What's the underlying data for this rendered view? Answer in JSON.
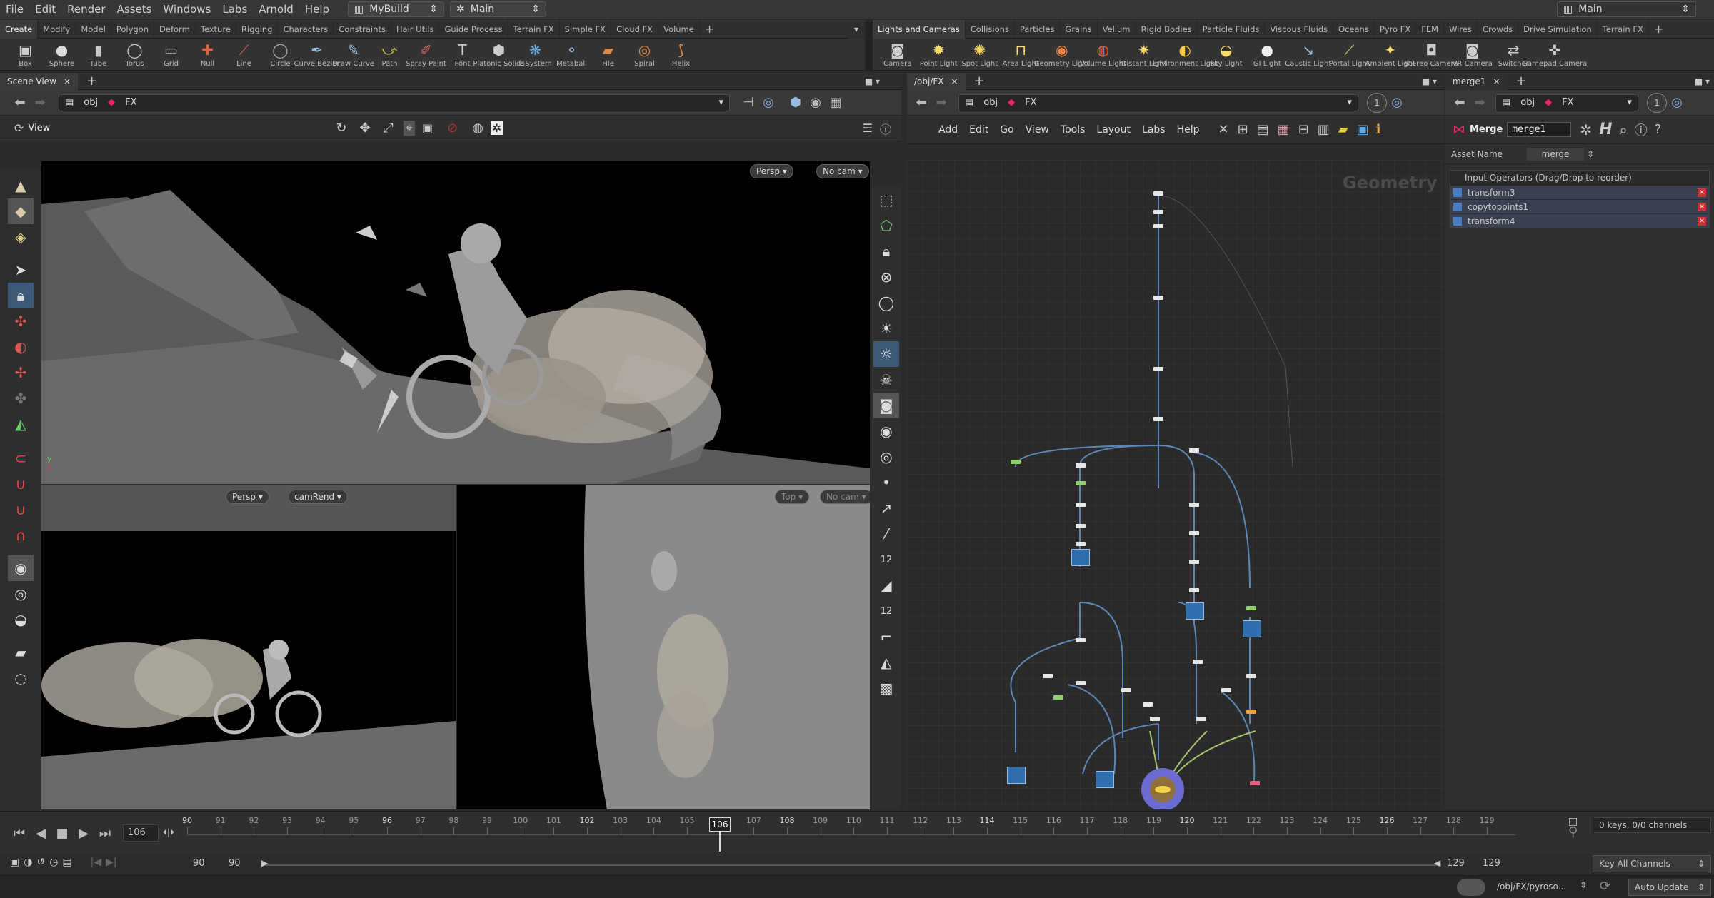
{
  "menubar": {
    "items": [
      "File",
      "Edit",
      "Render",
      "Assets",
      "Windows",
      "Labs",
      "Arnold",
      "Help"
    ],
    "build_dropdown": "MyBuild",
    "desktop_dropdown": "Main",
    "right_desktop": "Main"
  },
  "left_shelf": {
    "tabs": [
      "Create",
      "Modify",
      "Model",
      "Polygon",
      "Deform",
      "Texture",
      "Rigging",
      "Characters",
      "Constraints",
      "Hair Utils",
      "Guide Process",
      "Terrain FX",
      "Simple FX",
      "Cloud FX",
      "Volume"
    ],
    "active_tab": "Create",
    "tools": [
      {
        "label": "Box",
        "icon": "box-icon"
      },
      {
        "label": "Sphere",
        "icon": "sphere-icon"
      },
      {
        "label": "Tube",
        "icon": "tube-icon"
      },
      {
        "label": "Torus",
        "icon": "torus-icon"
      },
      {
        "label": "Grid",
        "icon": "grid-icon"
      },
      {
        "label": "Null",
        "icon": "null-icon"
      },
      {
        "label": "Line",
        "icon": "line-icon"
      },
      {
        "label": "Circle",
        "icon": "circle-icon"
      },
      {
        "label": "Curve Bezier",
        "icon": "curve-bezier-icon"
      },
      {
        "label": "Draw Curve",
        "icon": "draw-curve-icon"
      },
      {
        "label": "Path",
        "icon": "path-icon"
      },
      {
        "label": "Spray Paint",
        "icon": "spray-paint-icon"
      },
      {
        "label": "Font",
        "icon": "font-icon"
      },
      {
        "label": "Platonic Solids",
        "icon": "platonic-icon"
      },
      {
        "label": "L-System",
        "icon": "lsystem-icon"
      },
      {
        "label": "Metaball",
        "icon": "metaball-icon"
      },
      {
        "label": "File",
        "icon": "file-icon"
      },
      {
        "label": "Spiral",
        "icon": "spiral-icon"
      },
      {
        "label": "Helix",
        "icon": "helix-icon"
      }
    ]
  },
  "right_shelf": {
    "tabs": [
      "Lights and Cameras",
      "Collisions",
      "Particles",
      "Grains",
      "Vellum",
      "Rigid Bodies",
      "Particle Fluids",
      "Viscous Fluids",
      "Oceans",
      "Pyro FX",
      "FEM",
      "Wires",
      "Crowds",
      "Drive Simulation",
      "Terrain FX"
    ],
    "active_tab": "Lights and Cameras",
    "tools": [
      {
        "label": "Camera",
        "icon": "camera-icon"
      },
      {
        "label": "Point Light",
        "icon": "point-light-icon"
      },
      {
        "label": "Spot Light",
        "icon": "spot-light-icon"
      },
      {
        "label": "Area Light",
        "icon": "area-light-icon"
      },
      {
        "label": "Geometry Light",
        "icon": "geometry-light-icon"
      },
      {
        "label": "Volume Light",
        "icon": "volume-light-icon"
      },
      {
        "label": "Distant Light",
        "icon": "distant-light-icon"
      },
      {
        "label": "Environment Light",
        "icon": "environment-light-icon"
      },
      {
        "label": "Sky Light",
        "icon": "sky-light-icon"
      },
      {
        "label": "GI Light",
        "icon": "gi-light-icon"
      },
      {
        "label": "Caustic Light",
        "icon": "caustic-light-icon"
      },
      {
        "label": "Portal Light",
        "icon": "portal-light-icon"
      },
      {
        "label": "Ambient Light",
        "icon": "ambient-light-icon"
      },
      {
        "label": "Stereo Camera",
        "icon": "stereo-camera-icon"
      },
      {
        "label": "VR Camera",
        "icon": "vr-camera-icon"
      },
      {
        "label": "Switcher",
        "icon": "switcher-icon"
      },
      {
        "label": "Gamepad Camera",
        "icon": "gamepad-camera-icon"
      }
    ]
  },
  "scene_view": {
    "tab": "Scene View",
    "path": [
      "obj",
      "FX"
    ],
    "view_label": "View",
    "main_persp": "Persp",
    "main_cam": "No cam",
    "bl_persp": "Persp",
    "bl_cam": "camRend",
    "br_view": "Top",
    "br_cam": "No cam"
  },
  "network": {
    "tab": "/obj/FX",
    "path": [
      "obj",
      "FX"
    ],
    "menu": [
      "Add",
      "Edit",
      "Go",
      "View",
      "Tools",
      "Layout",
      "Labs",
      "Help"
    ],
    "watermark": "Geometry",
    "counter": "1"
  },
  "params": {
    "tab": "merge1",
    "path": [
      "obj",
      "FX"
    ],
    "node_type": "Merge",
    "node_name": "merge1",
    "asset_name_label": "Asset Name",
    "asset_name_value": "merge",
    "counter": "1",
    "inputs_header": "Input Operators (Drag/Drop to reorder)",
    "inputs": [
      "transform3",
      "copytopoints1",
      "transform4"
    ]
  },
  "timeline": {
    "frame": "106",
    "ticks": [
      "90",
      "91",
      "92",
      "93",
      "94",
      "95",
      "96",
      "97",
      "98",
      "99",
      "100",
      "101",
      "102",
      "103",
      "104",
      "105",
      "106",
      "107",
      "108",
      "109",
      "110",
      "111",
      "112",
      "113",
      "114",
      "115",
      "116",
      "117",
      "118",
      "119",
      "120",
      "121",
      "122",
      "123",
      "124",
      "125",
      "126",
      "127",
      "128",
      "129"
    ],
    "current": "106",
    "start1": "90",
    "start2": "90",
    "end1": "129",
    "end2": "129",
    "keys": "0 keys, 0/0 channels",
    "key_all": "Key All Channels",
    "status_path": "/obj/FX/pyroso...",
    "auto_update": "Auto Update"
  }
}
